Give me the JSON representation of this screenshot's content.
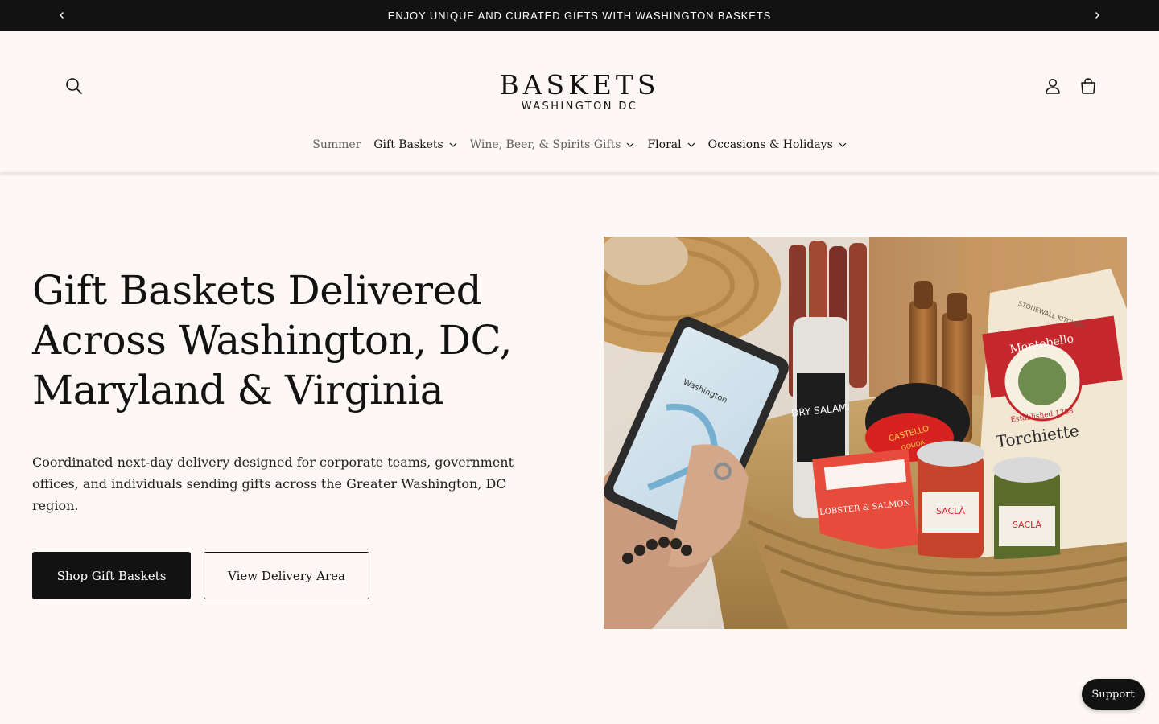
{
  "announcement": {
    "text": "ENJOY UNIQUE AND CURATED GIFTS WITH WASHINGTON BASKETS",
    "prev_icon": "chevron-left-icon",
    "next_icon": "chevron-right-icon"
  },
  "header": {
    "logo_main": "BASKETS",
    "logo_sub": "WASHINGTON DC",
    "search_icon": "search-icon",
    "account_icon": "user-icon",
    "cart_icon": "cart-icon"
  },
  "nav": {
    "items": [
      {
        "label": "Summer",
        "has_dropdown": false
      },
      {
        "label": "Gift Baskets",
        "has_dropdown": true
      },
      {
        "label": "Wine, Beer, & Spirits Gifts",
        "has_dropdown": true
      },
      {
        "label": "Floral",
        "has_dropdown": true
      },
      {
        "label": "Occasions & Holidays",
        "has_dropdown": true
      }
    ]
  },
  "hero": {
    "title_line1": "Gift Baskets Delivered",
    "title_line2": "Across Washington, DC,",
    "title_line3": "Maryland & Virginia",
    "description": "Coordinated next-day delivery designed for corporate teams, government offices, and individuals sending gifts across the Greater Washington, DC region.",
    "primary_button": "Shop Gift Baskets",
    "secondary_button": "View Delivery Area",
    "image_labels": {
      "salami": "DRY SALAMI",
      "cheese": "CASTELLO",
      "cheese_sub": "GOUDA",
      "pasta_brand": "Montebello",
      "pasta_est": "Established 1388",
      "pasta_name": "Torchiette",
      "pasta_maker": "STONEWALL KITCHEN",
      "lobster": "LOBSTER & SALMON",
      "jar1": "SACLÀ",
      "jar2": "SACLÀ",
      "map_city": "Washington"
    }
  },
  "support": {
    "label": "Support"
  },
  "colors": {
    "background": "#fdf8f6",
    "dark": "#121212",
    "muted_nav": "#5f5f5f"
  }
}
